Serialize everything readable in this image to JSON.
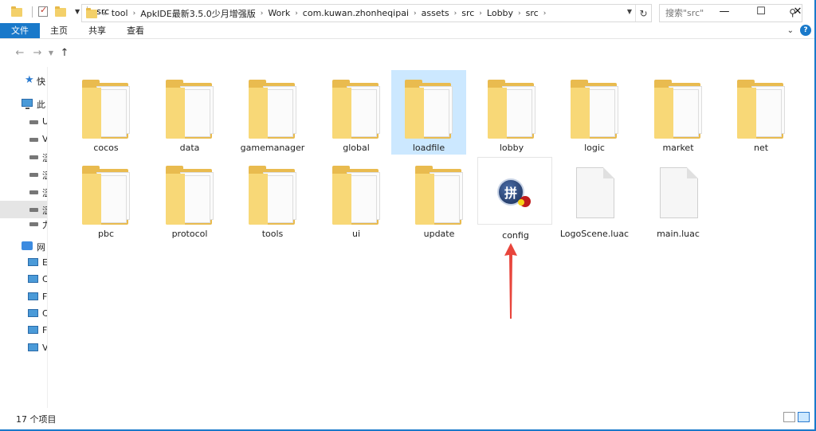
{
  "window": {
    "title": "src",
    "minimize_glyph": "—",
    "maximize_glyph": "☐",
    "close_glyph": "✕"
  },
  "ribbon": {
    "tabs": [
      "文件",
      "主页",
      "共享",
      "查看"
    ]
  },
  "address": {
    "lead": "«",
    "crumbs": [
      "tool",
      "ApkIDE最新3.5.0少月增强版",
      "Work",
      "com.kuwan.zhonheqipai",
      "assets",
      "src",
      "Lobby",
      "src"
    ]
  },
  "search": {
    "placeholder": "搜索\"src\""
  },
  "navpane": {
    "items": [
      {
        "label": "快",
        "icon": "star-icon"
      },
      {
        "label": "此",
        "icon": "computer-icon"
      },
      {
        "label": "U",
        "icon": "drive-icon"
      },
      {
        "label": "V",
        "icon": "drive-icon"
      },
      {
        "label": "涩",
        "icon": "drive-icon"
      },
      {
        "label": "涩",
        "icon": "drive-icon"
      },
      {
        "label": "涩",
        "icon": "drive-icon"
      },
      {
        "label": "涩",
        "icon": "drive-icon"
      },
      {
        "label": "力",
        "icon": "drive-icon"
      },
      {
        "label": "网",
        "icon": "network-icon"
      },
      {
        "label": "E",
        "icon": "monitor-icon"
      },
      {
        "label": "C",
        "icon": "monitor-icon"
      },
      {
        "label": "F",
        "icon": "monitor-icon"
      },
      {
        "label": "C",
        "icon": "monitor-icon"
      },
      {
        "label": "F",
        "icon": "monitor-icon"
      },
      {
        "label": "V",
        "icon": "monitor-icon"
      }
    ]
  },
  "files": [
    {
      "name": "cocos",
      "type": "folder"
    },
    {
      "name": "data",
      "type": "folder"
    },
    {
      "name": "gamemanager",
      "type": "folder"
    },
    {
      "name": "global",
      "type": "folder"
    },
    {
      "name": "loadfile",
      "type": "folder",
      "selected": true
    },
    {
      "name": "lobby",
      "type": "folder"
    },
    {
      "name": "logic",
      "type": "folder"
    },
    {
      "name": "market",
      "type": "folder"
    },
    {
      "name": "net",
      "type": "folder"
    },
    {
      "name": "pbc",
      "type": "folder"
    },
    {
      "name": "protocol",
      "type": "folder"
    },
    {
      "name": "tools",
      "type": "folder"
    },
    {
      "name": "ui",
      "type": "folder"
    },
    {
      "name": "update",
      "type": "folder"
    },
    {
      "name": "config",
      "type": "app",
      "glyph": "拼"
    },
    {
      "name": "LogoScene.luac",
      "type": "file"
    },
    {
      "name": "main.luac",
      "type": "file"
    }
  ],
  "status": {
    "count_text": "17 个项目"
  },
  "colors": {
    "accent": "#1979ca",
    "selection": "#cce8ff",
    "arrow": "#e8453c"
  }
}
